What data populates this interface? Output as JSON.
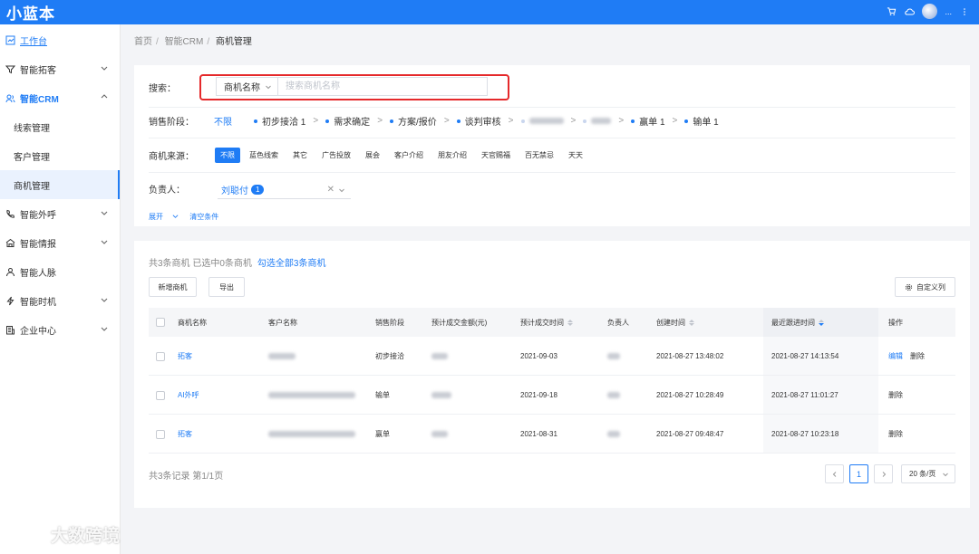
{
  "app": {
    "logo": "小蓝本"
  },
  "topbar": {
    "icons": [
      "cart-icon",
      "cloud-icon",
      "avatar",
      "more-icon"
    ],
    "user_dots": "..."
  },
  "sidebar": {
    "items": [
      {
        "label": "工作台",
        "icon": "workbench-icon"
      },
      {
        "label": "智能拓客",
        "icon": "funnel-icon"
      },
      {
        "label": "智能CRM",
        "icon": "crm-icon"
      },
      {
        "label": "智能外呼",
        "icon": "phone-icon"
      },
      {
        "label": "智能情报",
        "icon": "intel-icon"
      },
      {
        "label": "智能人脉",
        "icon": "people-icon"
      },
      {
        "label": "智能时机",
        "icon": "timing-icon"
      },
      {
        "label": "企业中心",
        "icon": "company-icon"
      }
    ],
    "crm_sub": [
      "线索管理",
      "客户管理",
      "商机管理"
    ]
  },
  "breadcrumb": [
    "首页",
    "智能CRM",
    "商机管理"
  ],
  "filters": {
    "search_label": "搜索：",
    "search_type": "商机名称",
    "search_placeholder": "搜索商机名称",
    "stage_label": "销售阶段：",
    "stage_all": "不限",
    "stages": [
      "初步接洽 1",
      "需求确定",
      "方案/报价",
      "谈判审核",
      "赢单 1",
      "输单 1"
    ],
    "source_label": "商机来源：",
    "sources": [
      "不限",
      "蓝色线索",
      "其它",
      "广告投放",
      "展会",
      "客户介绍",
      "朋友介绍",
      "天官赐福",
      "百无禁忌",
      "天天"
    ],
    "owner_label": "负责人：",
    "owner_name": "刘聪付",
    "owner_count": "1",
    "expand": "展开",
    "clear": "清空条件"
  },
  "table": {
    "summary": "共3条商机 已选中0条商机",
    "select_all": "勾选全部3条商机",
    "add_button": "新增商机",
    "export_button": "导出",
    "custom_columns": "自定义列",
    "columns": [
      "商机名称",
      "客户名称",
      "销售阶段",
      "预计成交金额(元)",
      "预计成交时间",
      "负责人",
      "创建时间",
      "最近跟进时间",
      "操作"
    ],
    "rows": [
      {
        "name": "拓客",
        "stage": "初步接洽",
        "expected_date": "2021-09-03",
        "created": "2021-08-27 13:48:02",
        "followup": "2021-08-27 14:13:54",
        "ops": [
          "编辑",
          "删除"
        ]
      },
      {
        "name": "AI外呼",
        "stage": "输单",
        "expected_date": "2021-09-18",
        "created": "2021-08-27 10:28:49",
        "followup": "2021-08-27 11:01:27",
        "ops": [
          "删除"
        ]
      },
      {
        "name": "拓客",
        "stage": "赢单",
        "expected_date": "2021-08-31",
        "created": "2021-08-27 09:48:47",
        "followup": "2021-08-27 10:23:18",
        "ops": [
          "删除"
        ]
      }
    ],
    "footer": "共3条记录 第1/1页",
    "current_page": "1",
    "page_size": "20 条/页"
  },
  "watermark": "大数跨境",
  "colors": {
    "brand": "#1f7cf5",
    "highlight": "#e5292b"
  }
}
